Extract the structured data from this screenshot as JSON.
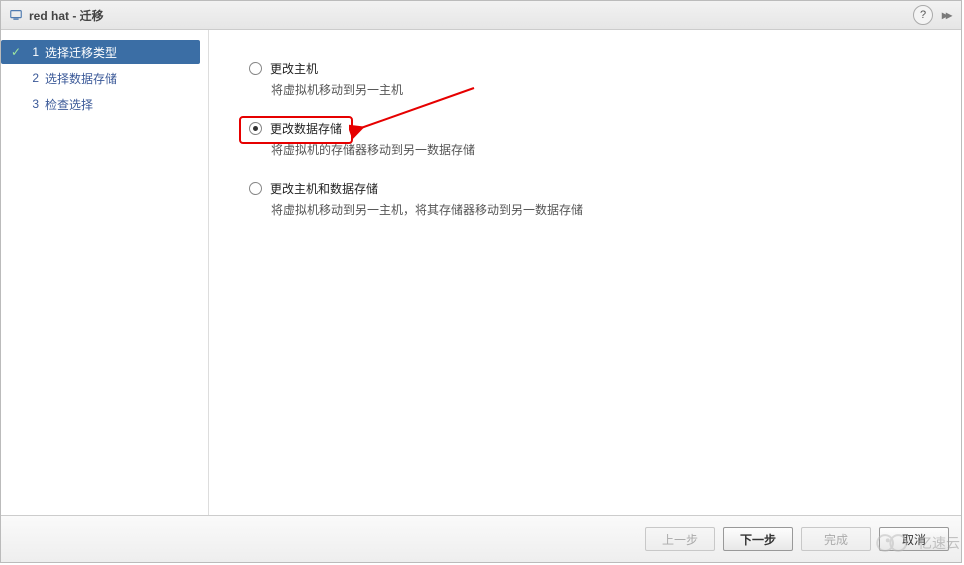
{
  "titlebar": {
    "title": "red hat - 迁移",
    "help_glyph": "?",
    "pin_glyph": "▸▸"
  },
  "sidebar": {
    "steps": [
      {
        "num": "1",
        "label": "选择迁移类型",
        "completed": true,
        "active": true
      },
      {
        "num": "2",
        "label": "选择数据存储",
        "completed": false,
        "active": false
      },
      {
        "num": "3",
        "label": "检查选择",
        "completed": false,
        "active": false
      }
    ]
  },
  "options": [
    {
      "id": "change-host",
      "label": "更改主机",
      "desc": "将虚拟机移动到另一主机",
      "selected": false
    },
    {
      "id": "change-datastore",
      "label": "更改数据存储",
      "desc": "将虚拟机的存储器移动到另一数据存储",
      "selected": true
    },
    {
      "id": "change-both",
      "label": "更改主机和数据存储",
      "desc": "将虚拟机移动到另一主机，将其存储器移动到另一数据存储",
      "selected": false
    }
  ],
  "footer": {
    "back": "上一步",
    "next": "下一步",
    "finish": "完成",
    "cancel": "取消"
  },
  "watermark": {
    "text": "亿速云"
  }
}
